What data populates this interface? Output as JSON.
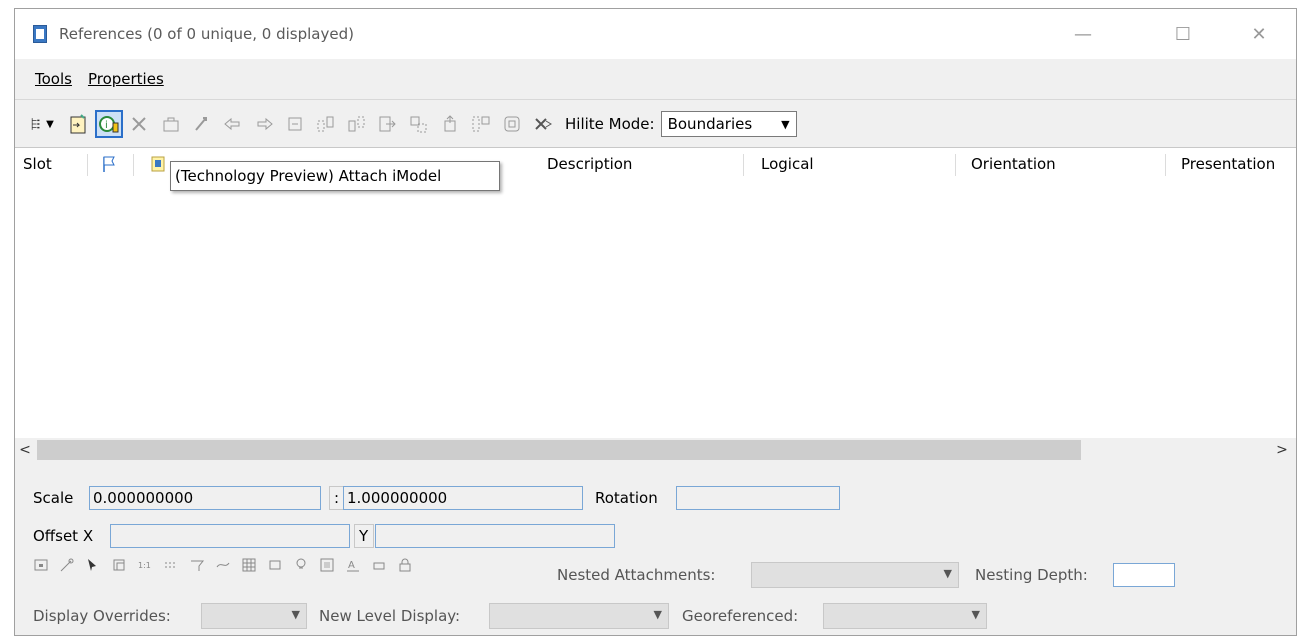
{
  "window": {
    "title": "References (0 of 0 unique, 0 displayed)"
  },
  "menu": {
    "tools": "Tools",
    "properties": "Properties"
  },
  "toolbar": {
    "hilite_label": "Hilite Mode:",
    "hilite_value": "Boundaries",
    "buttons": [
      "tree-view",
      "attach-reference",
      "attach-imodel",
      "detach",
      "reload",
      "move",
      "copy",
      "scale",
      "rotate",
      "mirror-horizontal",
      "mirror-vertical",
      "clip-boundary",
      "clip-mask",
      "clip-delete",
      "clip-front",
      "clip-back",
      "make-display",
      "exchange"
    ]
  },
  "tooltip": "(Technology Preview) Attach iModel",
  "columns": [
    "Slot",
    "Description",
    "Logical",
    "Orientation",
    "Presentation"
  ],
  "settings": {
    "scale_label": "Scale",
    "scale_value": "0.000000000",
    "scale_sep": ":",
    "scale_value2": "1.000000000",
    "rotation_label": "Rotation",
    "rotation_value": "",
    "offset_x_label": "Offset X",
    "offset_x_value": "",
    "offset_y_label": "Y",
    "offset_y_value": "",
    "nested_label": "Nested Attachments:",
    "nesting_depth_label": "Nesting Depth:",
    "display_overrides_label": "Display Overrides:",
    "new_level_display_label": "New Level Display:",
    "georeferenced_label": "Georeferenced:"
  },
  "colors": {
    "accent": "#2b6fc9",
    "toolbar_bg": "#f0f0f0"
  }
}
